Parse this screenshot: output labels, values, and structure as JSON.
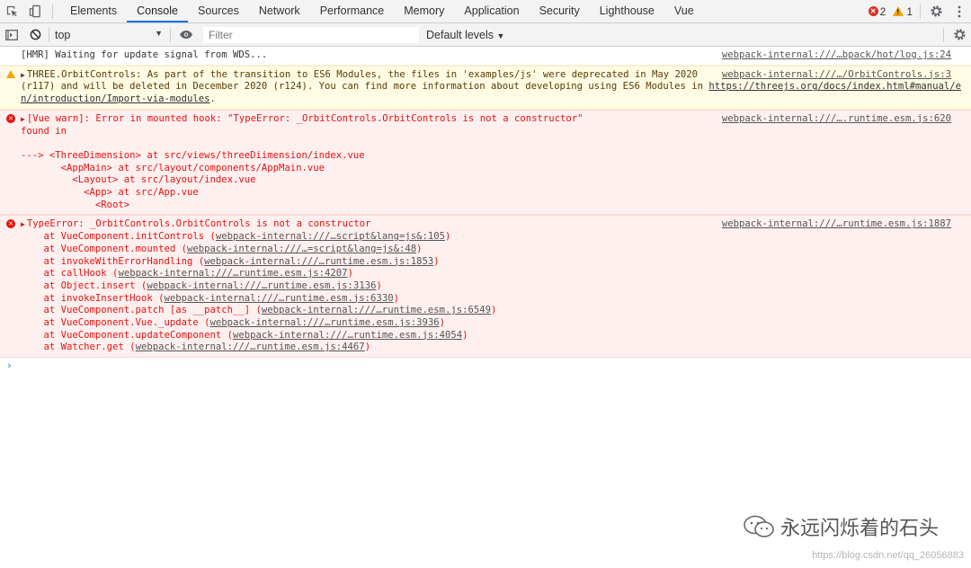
{
  "tabs": [
    "Elements",
    "Console",
    "Sources",
    "Network",
    "Performance",
    "Memory",
    "Application",
    "Security",
    "Lighthouse",
    "Vue"
  ],
  "active_tab": "Console",
  "counts": {
    "errors": "2",
    "warnings": "1"
  },
  "toolbar": {
    "context": "top",
    "filter_placeholder": "Filter",
    "levels": "Default levels"
  },
  "messages": {
    "hmr": {
      "text": "[HMR] Waiting for update signal from WDS...",
      "source": "webpack-internal:///…bpack/hot/log.js:24"
    },
    "warn": {
      "line1": "THREE.OrbitControls: As part of the transition to ES6 Modules, the files in 'examples/js' were deprecated in May 2020",
      "line2a": "(r117) and will be deleted in December 2020 (r124). You can find more information about developing using ES6 Modules in ",
      "link_a": "https://threejs.org/docs/index.html#manual/e",
      "link_b": "n/introduction/Import-via-modules",
      "tail": ".",
      "source": "webpack-internal:///…/OrbitControls.js:3"
    },
    "vue_warn": {
      "line1": "[Vue warn]: Error in mounted hook: \"TypeError: _OrbitControls.OrbitControls is not a constructor\"",
      "blank": "",
      "found": "found in",
      "trace1": "---> <ThreeDimension> at src/views/threeDiimension/index.vue",
      "trace2": "       <AppMain> at src/layout/components/AppMain.vue",
      "trace3": "         <Layout> at src/layout/index.vue",
      "trace4": "           <App> at src/App.vue",
      "trace5": "             <Root>",
      "source": "webpack-internal:///….runtime.esm.js:620"
    },
    "type_error": {
      "line1": "TypeError: _OrbitControls.OrbitControls is not a constructor",
      "source": "webpack-internal:///…runtime.esm.js:1887",
      "stack": [
        {
          "pre": "    at VueComponent.initControls (",
          "link": "webpack-internal:///…script&lang=js&:105",
          "post": ")"
        },
        {
          "pre": "    at VueComponent.mounted (",
          "link": "webpack-internal:///…=script&lang=js&:48",
          "post": ")"
        },
        {
          "pre": "    at invokeWithErrorHandling (",
          "link": "webpack-internal:///…runtime.esm.js:1853",
          "post": ")"
        },
        {
          "pre": "    at callHook (",
          "link": "webpack-internal:///…runtime.esm.js:4207",
          "post": ")"
        },
        {
          "pre": "    at Object.insert (",
          "link": "webpack-internal:///…runtime.esm.js:3136",
          "post": ")"
        },
        {
          "pre": "    at invokeInsertHook (",
          "link": "webpack-internal:///…runtime.esm.js:6330",
          "post": ")"
        },
        {
          "pre": "    at VueComponent.patch [as __patch__] (",
          "link": "webpack-internal:///…runtime.esm.js:6549",
          "post": ")"
        },
        {
          "pre": "    at VueComponent.Vue._update (",
          "link": "webpack-internal:///…runtime.esm.js:3936",
          "post": ")"
        },
        {
          "pre": "    at VueComponent.updateComponent (",
          "link": "webpack-internal:///…runtime.esm.js:4054",
          "post": ")"
        },
        {
          "pre": "    at Watcher.get (",
          "link": "webpack-internal:///…runtime.esm.js:4467",
          "post": ")"
        }
      ]
    }
  },
  "prompt": "›",
  "watermark": {
    "text": "永远闪烁着的石头",
    "url": "https://blog.csdn.net/qq_26056883"
  },
  "icons": {
    "inspect": "inspect-icon",
    "device": "device-toggle-icon",
    "settings": "gear-icon",
    "more": "more-vert-icon",
    "sidebar": "sidebar-toggle-icon",
    "clear": "clear-console-icon",
    "eye": "eye-icon",
    "dropdown": "chevron-down-icon"
  },
  "colors": {
    "accent": "#1a73e8",
    "error": "#e8120e",
    "warning": "#f2a600",
    "error_bg": "#fff0f0",
    "warn_bg": "#fffbe5"
  }
}
